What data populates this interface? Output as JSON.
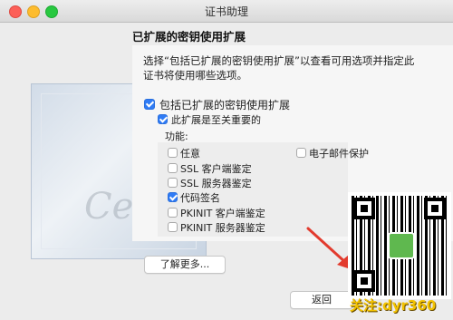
{
  "window": {
    "title": "证书助理"
  },
  "section": {
    "heading": "已扩展的密钥使用扩展",
    "description": "选择“包括已扩展的密钥使用扩展”以查看可用选项并指定此证书将使用哪些选项。"
  },
  "options": {
    "include_label": "包括已扩展的密钥使用扩展",
    "include_checked": true,
    "critical_label": "此扩展是至关重要的",
    "critical_checked": true,
    "features_label": "功能:"
  },
  "features": [
    {
      "label": "任意",
      "checked": false
    },
    {
      "label": "SSL 客户端鉴定",
      "checked": false
    },
    {
      "label": "SSL 服务器鉴定",
      "checked": false
    },
    {
      "label": "代码签名",
      "checked": true
    },
    {
      "label": "PKINIT 客户端鉴定",
      "checked": false
    },
    {
      "label": "PKINIT 服务器鉴定",
      "checked": false
    },
    {
      "label": "电子邮件保护",
      "checked": false
    }
  ],
  "buttons": {
    "learn_more": "了解更多...",
    "back": "返回"
  },
  "image": {
    "cert_text": "Certificate"
  },
  "watermark": {
    "text": "关注:dyr360"
  },
  "colors": {
    "accent": "#2f7bf5",
    "arrow": "#e23b2e",
    "watermark": "#f2c200"
  }
}
